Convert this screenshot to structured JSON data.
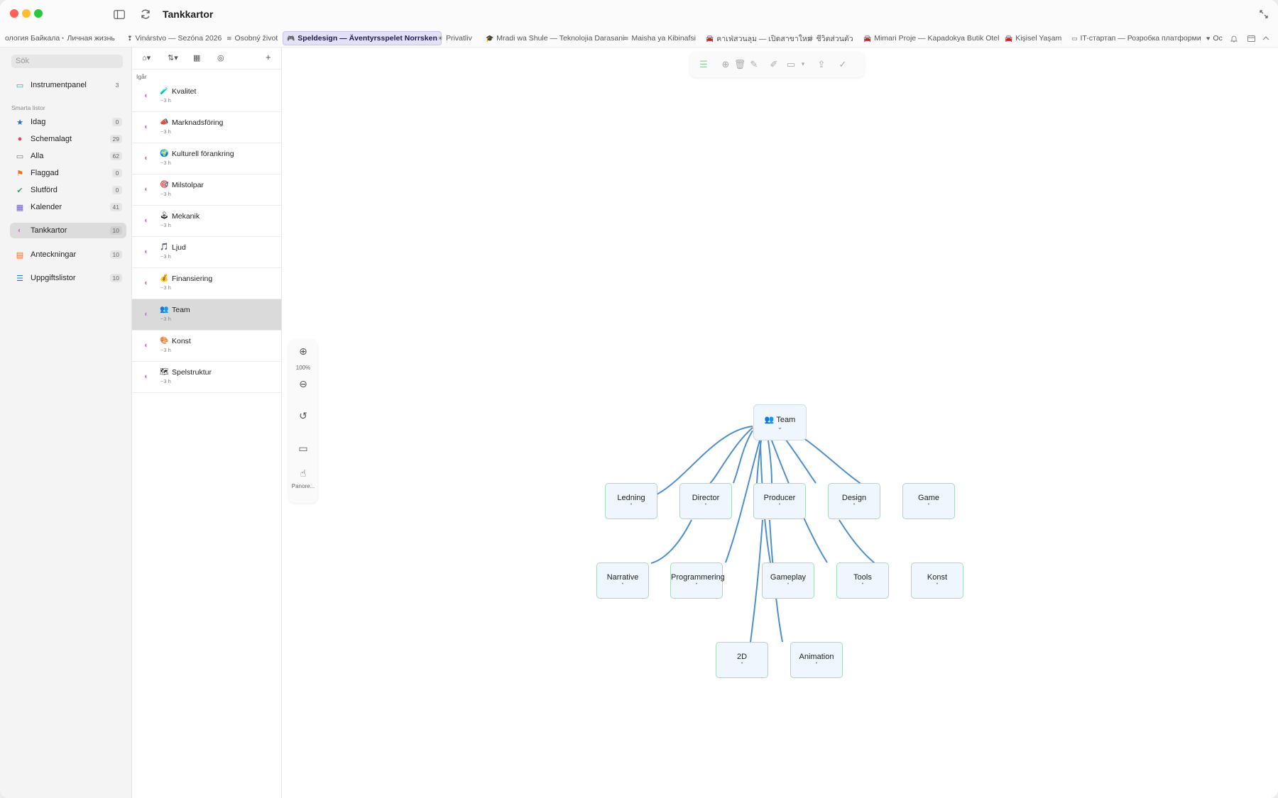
{
  "window": {
    "title": "Tankkartor"
  },
  "tabs": [
    {
      "label": "ология Байкала",
      "icon": ""
    },
    {
      "label": "Личная жизнь",
      "icon": "◔"
    },
    {
      "label": "Vinárstvo — Sezóna 2026",
      "icon": "❢"
    },
    {
      "label": "Osobný život",
      "icon": "≋"
    },
    {
      "label": "Speldesign — Äventyrsspelet Norrsken",
      "icon": "🎮"
    },
    {
      "label": "Privatliv",
      "icon": "☀"
    },
    {
      "label": "Mradi wa Shule — Teknolojia Darasani",
      "icon": "🎓"
    },
    {
      "label": "Maisha ya Kibinafsi",
      "icon": "≋"
    },
    {
      "label": "คาเฟ่สวนลุม — เปิดสาขาใหม่",
      "icon": "🚘"
    },
    {
      "label": "ชีวิตส่วนตัว",
      "icon": "≋"
    },
    {
      "label": "Mimari Proje — Kapadokya Butik Otel",
      "icon": "🚘"
    },
    {
      "label": "Kişisel Yaşam",
      "icon": "🚘"
    },
    {
      "label": "IT-стартап — Розробка платформи",
      "icon": "▭"
    },
    {
      "label": "Oc",
      "icon": "♥"
    }
  ],
  "sidebar": {
    "search_placeholder": "Sök",
    "top": {
      "label": "Instrumentpanel",
      "count": "3"
    },
    "section_label": "Smarta listor",
    "smart": [
      {
        "label": "Idag",
        "count": "0",
        "icon": "★",
        "color": "#1f6feb"
      },
      {
        "label": "Schemalagt",
        "count": "29",
        "icon": "●",
        "color": "#e5484d"
      },
      {
        "label": "Alla",
        "count": "62",
        "icon": "▭",
        "color": "#777777"
      },
      {
        "label": "Flaggad",
        "count": "0",
        "icon": "⚑",
        "color": "#f76b15"
      },
      {
        "label": "Slutförd",
        "count": "0",
        "icon": "✔",
        "color": "#30a46c"
      },
      {
        "label": "Kalender",
        "count": "41",
        "icon": "▦",
        "color": "#6e56cf"
      }
    ],
    "mindmaps": {
      "label": "Tankkartor",
      "count": "10"
    },
    "notes": {
      "label": "Anteckningar",
      "count": "10"
    },
    "tasks": {
      "label": "Uppgiftslistor",
      "count": "10"
    }
  },
  "list": {
    "group": "Igår",
    "items": [
      {
        "emoji": "🧪",
        "title": "Kvalitet",
        "sub": "~3 h"
      },
      {
        "emoji": "📣",
        "title": "Marknadsföring",
        "sub": "~3 h"
      },
      {
        "emoji": "🌍",
        "title": "Kulturell förankring",
        "sub": "~3 h"
      },
      {
        "emoji": "🎯",
        "title": "Milstolpar",
        "sub": "~3 h"
      },
      {
        "emoji": "🕹",
        "title": "Mekanik",
        "sub": "~3 h"
      },
      {
        "emoji": "🎵",
        "title": "Ljud",
        "sub": "~3 h"
      },
      {
        "emoji": "💰",
        "title": "Finansiering",
        "sub": "~3 h"
      },
      {
        "emoji": "👥",
        "title": "Team",
        "sub": "~3 h"
      },
      {
        "emoji": "🎨",
        "title": "Konst",
        "sub": "~3 h"
      },
      {
        "emoji": "🗺",
        "title": "Spelstruktur",
        "sub": "~3 h"
      }
    ]
  },
  "zoom": {
    "level": "100%",
    "pan_label": "Panore..."
  },
  "mindmap": {
    "root": {
      "emoji": "👥",
      "label": "Team"
    },
    "nodes": [
      "Ledning",
      "Director",
      "Producer",
      "Design",
      "Game",
      "Narrative",
      "Programmering",
      "Gameplay",
      "Tools",
      "Konst",
      "2D",
      "Animation"
    ]
  }
}
